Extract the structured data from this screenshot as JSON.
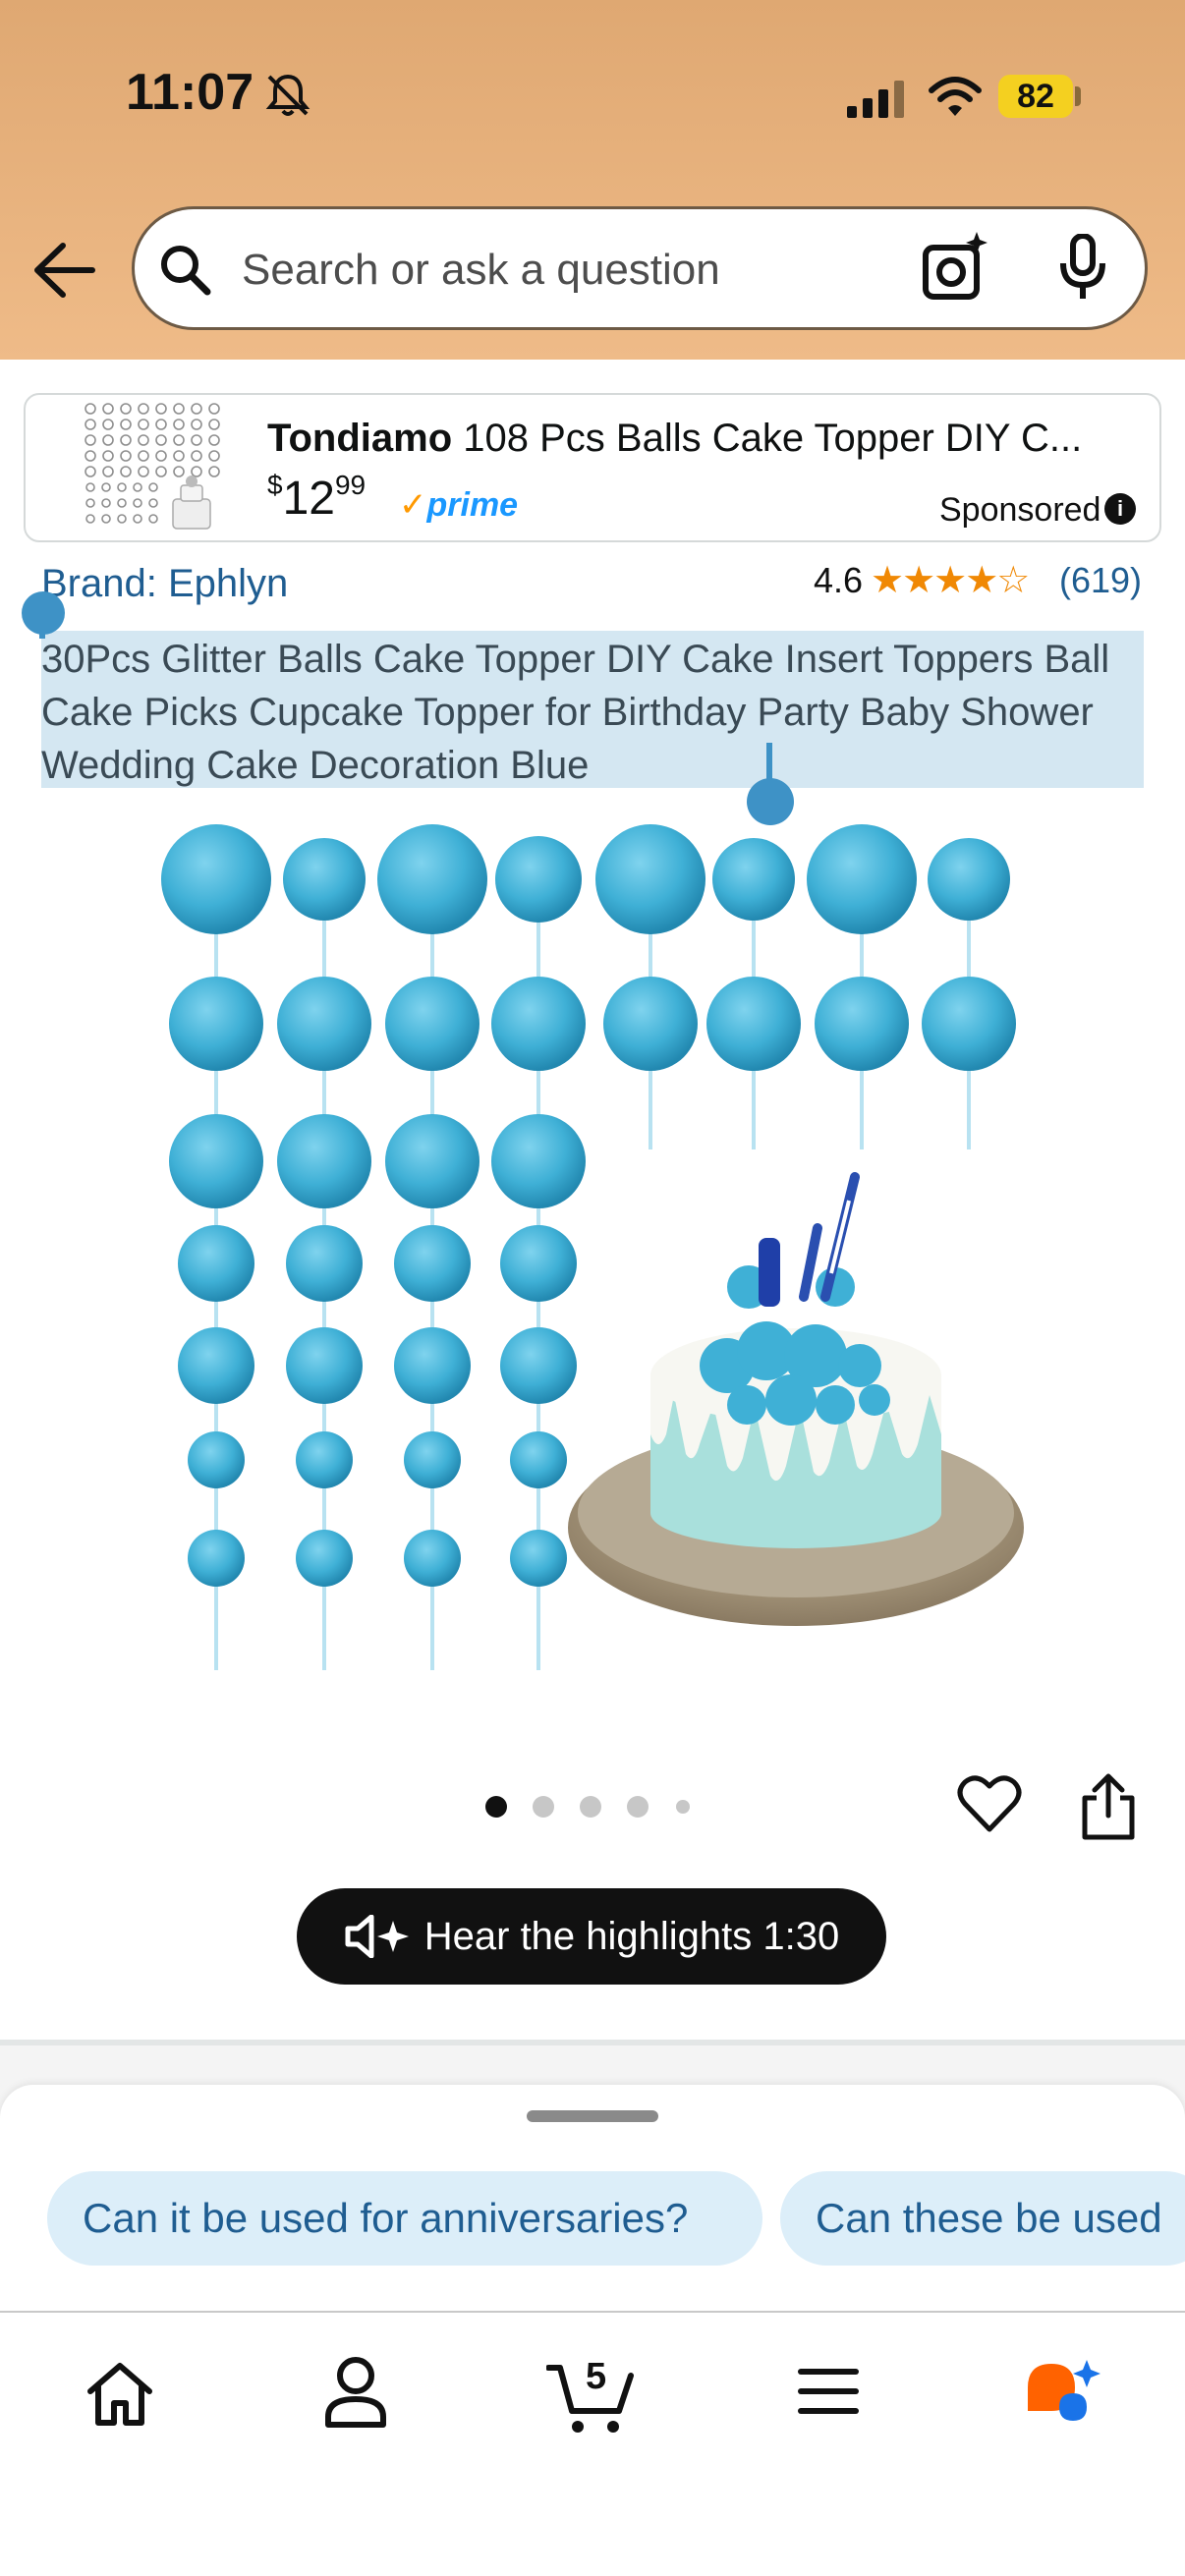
{
  "status_bar": {
    "time": "11:07",
    "battery": "82"
  },
  "search": {
    "placeholder": "Search or ask a question"
  },
  "sponsored": {
    "brand": "Tondiamo",
    "title": "108 Pcs Balls Cake Topper DIY C...",
    "price_symbol": "$",
    "price_whole": "12",
    "price_fraction": "99",
    "prime_label": "prime",
    "label": "Sponsored",
    "info": "i"
  },
  "product": {
    "brand_link": "Brand: Ephlyn",
    "rating": 4.6,
    "rating_text": "4.6",
    "rating_stars": "★★★★☆",
    "rating_count": "(619)",
    "title": "30Pcs Glitter Balls Cake Topper DIY Cake Insert Toppers Ball Cake Picks Cupcake Topper for Birthday Party Baby Shower Wedding Cake Decoration Blue",
    "image_count": 5,
    "current_image": 1
  },
  "audio": {
    "hear_label": "Hear the highlights 1:30"
  },
  "questions": [
    "Can it be used for anniversaries?",
    "Can these be used"
  ],
  "nav": {
    "cart_count": "5"
  },
  "colors": {
    "header": "#e8b47e",
    "link": "#1f5d91",
    "star": "#f08804",
    "prime": "#1a98ff",
    "chip_bg": "#dceef9",
    "selection": "#d4e7f2",
    "ball": "#3fb0d6"
  },
  "icons": [
    "bell-slash-icon",
    "signal-icon",
    "wifi-icon",
    "back-arrow-icon",
    "search-icon",
    "camera-icon",
    "mic-icon",
    "heart-icon",
    "share-icon",
    "speaker-sparkle-icon",
    "home-icon",
    "account-icon",
    "cart-icon",
    "menu-icon",
    "rufus-icon"
  ]
}
